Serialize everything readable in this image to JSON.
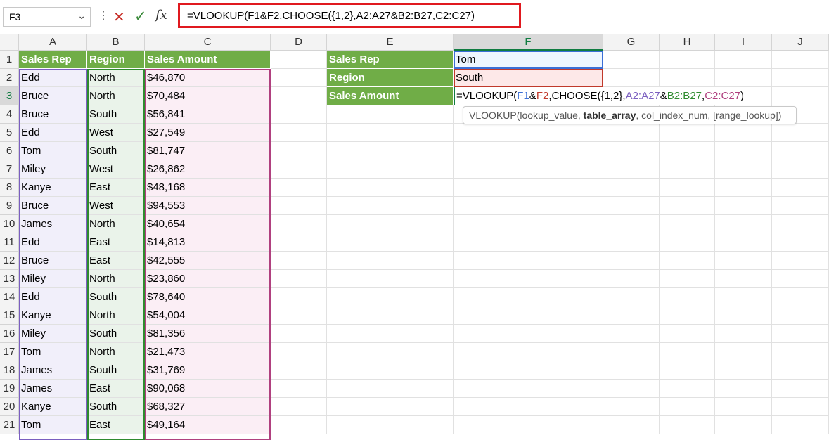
{
  "formula_bar": {
    "name_box": "F3",
    "formula": "=VLOOKUP(F1&F2,CHOOSE({1,2},A2:A27&B2:B27,C2:C27)"
  },
  "columns": [
    "A",
    "B",
    "C",
    "D",
    "E",
    "F",
    "G",
    "H",
    "I",
    "J"
  ],
  "rows": [
    "1",
    "2",
    "3",
    "4",
    "5",
    "6",
    "7",
    "8",
    "9",
    "10",
    "11",
    "12",
    "13",
    "14",
    "15",
    "16",
    "17",
    "18",
    "19",
    "20",
    "21"
  ],
  "table": {
    "headers": [
      "Sales Rep",
      "Region",
      "Sales Amount"
    ],
    "data": [
      [
        "Edd",
        "North",
        "$46,870"
      ],
      [
        "Bruce",
        "North",
        "$70,484"
      ],
      [
        "Bruce",
        "South",
        "$56,841"
      ],
      [
        "Edd",
        "West",
        "$27,549"
      ],
      [
        "Tom",
        "South",
        "$81,747"
      ],
      [
        "Miley",
        "West",
        "$26,862"
      ],
      [
        "Kanye",
        "East",
        "$48,168"
      ],
      [
        "Bruce",
        "West",
        "$94,553"
      ],
      [
        "James",
        "North",
        "$40,654"
      ],
      [
        "Edd",
        "East",
        "$14,813"
      ],
      [
        "Bruce",
        "East",
        "$42,555"
      ],
      [
        "Miley",
        "North",
        "$23,860"
      ],
      [
        "Edd",
        "South",
        "$78,640"
      ],
      [
        "Kanye",
        "North",
        "$54,004"
      ],
      [
        "Miley",
        "South",
        "$81,356"
      ],
      [
        "Tom",
        "North",
        "$21,473"
      ],
      [
        "James",
        "South",
        "$31,769"
      ],
      [
        "James",
        "East",
        "$90,068"
      ],
      [
        "Kanye",
        "South",
        "$68,327"
      ],
      [
        "Tom",
        "East",
        "$49,164"
      ]
    ]
  },
  "lookup": {
    "labels": [
      "Sales Rep",
      "Region",
      "Sales Amount"
    ],
    "sales_rep_value": "Tom",
    "region_value": "South",
    "edit_parts": [
      "=VLOOKUP(",
      "F1",
      "&",
      "F2",
      ",CHOOSE(",
      "{1,2}",
      ",",
      "A2:A27",
      "&",
      "B2:B27",
      ",",
      "C2:C27",
      ")"
    ]
  },
  "tooltip": {
    "fn": "VLOOKUP(",
    "arg1": "lookup_value, ",
    "arg2": "table_array",
    "rest": ", col_index_num, [range_lookup])"
  },
  "colors": {
    "header_green": "#70ad47",
    "excel_green": "#107c41",
    "highlight_red": "#e0191f",
    "ref_blue": "#3b6fd6",
    "ref_red": "#c0392b",
    "ref_purple": "#7b5fc0",
    "ref_green": "#2e8b2e",
    "ref_magenta": "#b0407f"
  }
}
